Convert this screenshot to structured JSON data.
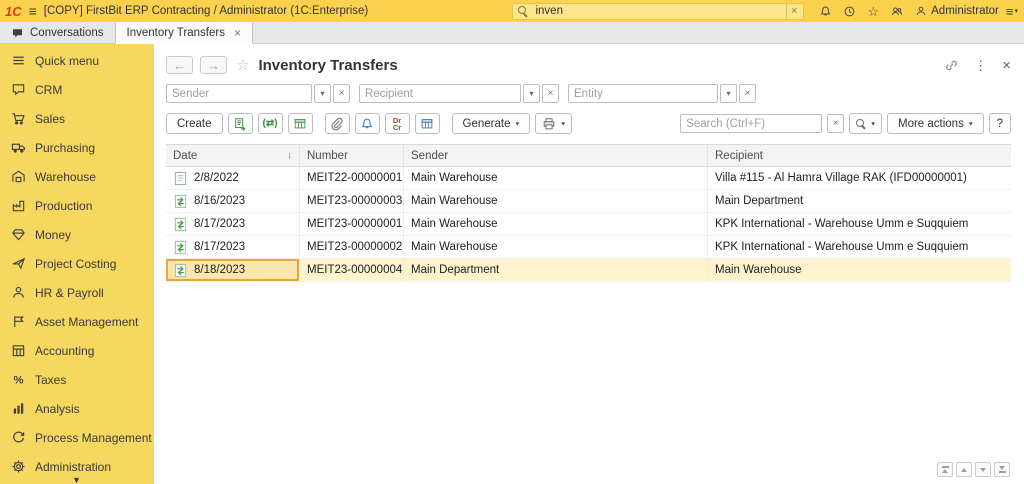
{
  "topbar": {
    "logo": "1C",
    "title": "[COPY] FirstBit ERP Contracting / Administrator  (1C:Enterprise)",
    "search": {
      "value": "inven"
    },
    "user_label": "Administrator"
  },
  "tabbar": {
    "tabs": [
      {
        "label": "Conversations"
      },
      {
        "label": "Inventory Transfers"
      }
    ]
  },
  "sidebar": {
    "items": [
      {
        "label": "Quick menu"
      },
      {
        "label": "CRM"
      },
      {
        "label": "Sales"
      },
      {
        "label": "Purchasing"
      },
      {
        "label": "Warehouse"
      },
      {
        "label": "Production"
      },
      {
        "label": "Money"
      },
      {
        "label": "Project Costing"
      },
      {
        "label": "HR & Payroll"
      },
      {
        "label": "Asset Management"
      },
      {
        "label": "Accounting"
      },
      {
        "label": "Taxes"
      },
      {
        "label": "Analysis"
      },
      {
        "label": "Process Management"
      },
      {
        "label": "Administration"
      }
    ]
  },
  "page": {
    "title": "Inventory Transfers",
    "filters": {
      "sender_placeholder": "Sender",
      "recipient_placeholder": "Recipient",
      "entity_placeholder": "Entity"
    },
    "toolbar": {
      "create": "Create",
      "generate": "Generate",
      "search_placeholder": "Search (Ctrl+F)",
      "more_actions": "More actions",
      "help": "?",
      "drcr_top": "Dr",
      "drcr_bottom": "Cr",
      "interval_glyph": "(⇄)"
    },
    "table": {
      "columns": [
        "Date",
        "Number",
        "Sender",
        "Recipient"
      ],
      "rows": [
        {
          "icon": "draft",
          "date": "2/8/2022",
          "number": "MEIT22-00000001",
          "sender": "Main Warehouse",
          "recipient": "Villa #115 - Al Hamra Village RAK (IFD00000001)"
        },
        {
          "icon": "posted",
          "date": "8/16/2023",
          "number": "MEIT23-00000003",
          "sender": "Main Warehouse",
          "recipient": "Main Department"
        },
        {
          "icon": "posted",
          "date": "8/17/2023",
          "number": "MEIT23-00000001",
          "sender": "Main Warehouse",
          "recipient": "KPK International - Warehouse Umm e Suqquiem"
        },
        {
          "icon": "posted",
          "date": "8/17/2023",
          "number": "MEIT23-00000002",
          "sender": "Main Warehouse",
          "recipient": "KPK International - Warehouse Umm e Suqquiem"
        },
        {
          "icon": "posted",
          "date": "8/18/2023",
          "number": "MEIT23-00000004",
          "sender": "Main Department",
          "recipient": "Main Warehouse"
        }
      ]
    }
  },
  "icons": {
    "back": "←",
    "forward": "→",
    "favorite": "☆",
    "close": "×",
    "menu_dots": "⋮",
    "sort_desc": "↓",
    "dropdown": "▾",
    "clear": "×",
    "hamburger": "≡",
    "scroll_more": "▼"
  }
}
